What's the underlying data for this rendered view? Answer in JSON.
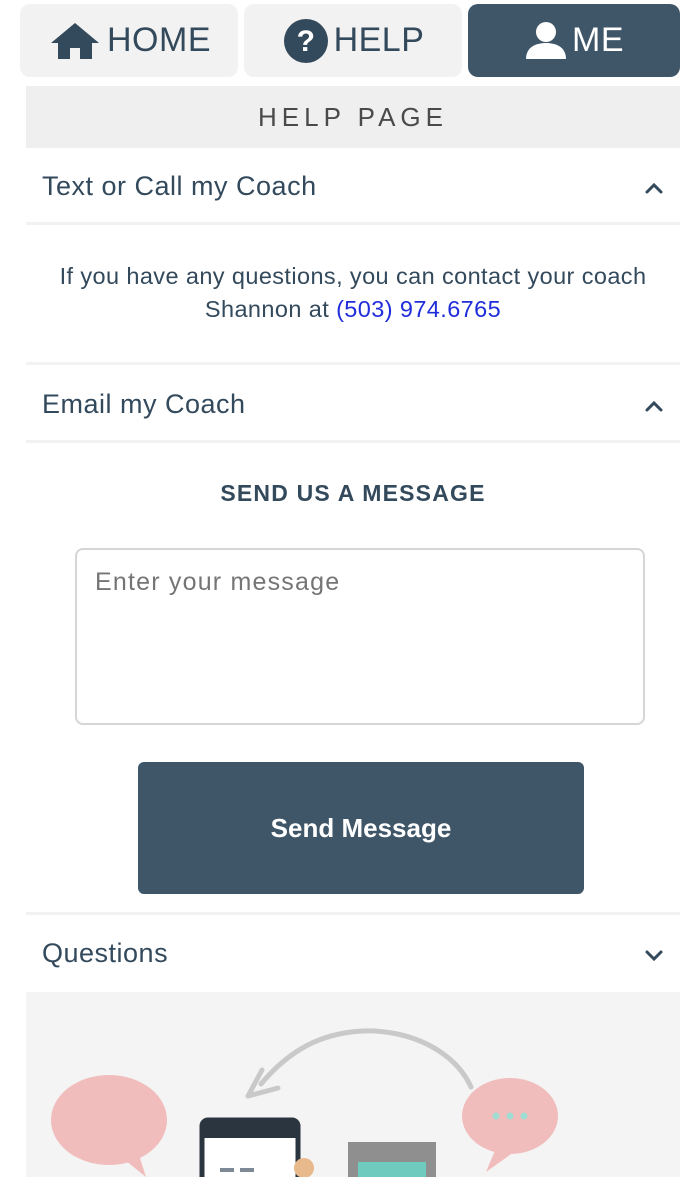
{
  "nav": {
    "home_label": "HOME",
    "help_label": "HELP",
    "me_label": "ME"
  },
  "page": {
    "title": "HELP PAGE"
  },
  "sections": {
    "text_call": {
      "title": "Text or Call my Coach",
      "body_prefix": "If you have any questions, you can contact your coach Shannon at",
      "phone": "(503) 974.6765"
    },
    "email": {
      "title": "Email my Coach",
      "heading": "SEND US A MESSAGE",
      "placeholder": "Enter your message",
      "value": "",
      "button_label": "Send Message"
    },
    "questions": {
      "title": "Questions"
    }
  },
  "colors": {
    "primary": "#3f5669",
    "text": "#33495c",
    "link": "#1f2ddb",
    "bubble_pink": "#f1bcbc"
  }
}
